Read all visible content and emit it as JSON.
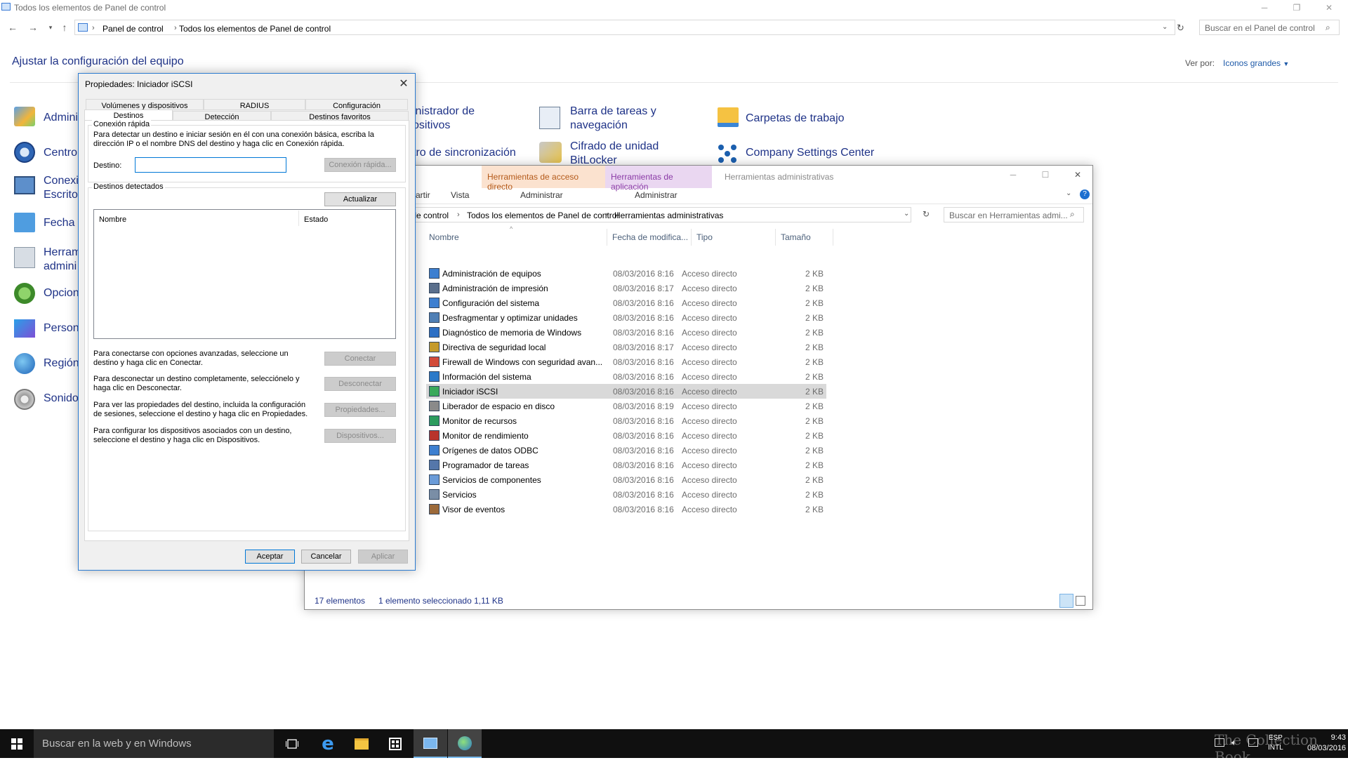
{
  "control_panel": {
    "window_title": "Todos los elementos de Panel de control",
    "breadcrumb": [
      "Panel de control",
      "Todos los elementos de Panel de control"
    ],
    "search_placeholder": "Buscar en el Panel de control",
    "heading": "Ajustar la configuración del equipo",
    "view_by_label": "Ver por:",
    "view_by_value": "Iconos grandes",
    "left_items": [
      "Admini",
      "Centro",
      "Conexi",
      "Escritor",
      "Fecha y",
      "Herram",
      "admini",
      "Opcion",
      "Person",
      "Región",
      "Sonido"
    ],
    "items_col2": [
      "inistrador de",
      "ositivos",
      "tro de sincronización"
    ],
    "items_col3": [
      "Barra de tareas y",
      "navegación",
      "Cifrado de unidad",
      "BitLocker"
    ],
    "items_col4": [
      "Carpetas de trabajo",
      "Company Settings Center"
    ]
  },
  "explorer": {
    "ctx_tab_shortcut": "Herramientas de acceso directo",
    "ctx_tab_app": "Herramientas de aplicación",
    "window_title": "Herramientas administrativas",
    "ribbon_tabs": [
      "artir",
      "Vista",
      "Administrar",
      "Administrar"
    ],
    "breadcrumb": [
      "nel de control",
      "Todos los elementos de Panel de control",
      "Herramientas administrativas"
    ],
    "search_placeholder": "Buscar en Herramientas admi...",
    "columns": [
      "Nombre",
      "Fecha de modifica...",
      "Tipo",
      "Tamaño"
    ],
    "rows": [
      {
        "name": "Administración de equipos",
        "date": "08/03/2016 8:16",
        "type": "Acceso directo",
        "size": "2 KB"
      },
      {
        "name": "Administración de impresión",
        "date": "08/03/2016 8:17",
        "type": "Acceso directo",
        "size": "2 KB"
      },
      {
        "name": "Configuración del sistema",
        "date": "08/03/2016 8:16",
        "type": "Acceso directo",
        "size": "2 KB"
      },
      {
        "name": "Desfragmentar y optimizar unidades",
        "date": "08/03/2016 8:16",
        "type": "Acceso directo",
        "size": "2 KB"
      },
      {
        "name": "Diagnóstico de memoria de Windows",
        "date": "08/03/2016 8:16",
        "type": "Acceso directo",
        "size": "2 KB"
      },
      {
        "name": "Directiva de seguridad local",
        "date": "08/03/2016 8:17",
        "type": "Acceso directo",
        "size": "2 KB"
      },
      {
        "name": "Firewall de Windows con seguridad avan...",
        "date": "08/03/2016 8:16",
        "type": "Acceso directo",
        "size": "2 KB"
      },
      {
        "name": "Información del sistema",
        "date": "08/03/2016 8:16",
        "type": "Acceso directo",
        "size": "2 KB"
      },
      {
        "name": "Iniciador iSCSI",
        "date": "08/03/2016 8:16",
        "type": "Acceso directo",
        "size": "2 KB"
      },
      {
        "name": "Liberador de espacio en disco",
        "date": "08/03/2016 8:19",
        "type": "Acceso directo",
        "size": "2 KB"
      },
      {
        "name": "Monitor de recursos",
        "date": "08/03/2016 8:16",
        "type": "Acceso directo",
        "size": "2 KB"
      },
      {
        "name": "Monitor de rendimiento",
        "date": "08/03/2016 8:16",
        "type": "Acceso directo",
        "size": "2 KB"
      },
      {
        "name": "Orígenes de datos ODBC",
        "date": "08/03/2016 8:16",
        "type": "Acceso directo",
        "size": "2 KB"
      },
      {
        "name": "Programador de tareas",
        "date": "08/03/2016 8:16",
        "type": "Acceso directo",
        "size": "2 KB"
      },
      {
        "name": "Servicios de componentes",
        "date": "08/03/2016 8:16",
        "type": "Acceso directo",
        "size": "2 KB"
      },
      {
        "name": "Servicios",
        "date": "08/03/2016 8:16",
        "type": "Acceso directo",
        "size": "2 KB"
      },
      {
        "name": "Visor de eventos",
        "date": "08/03/2016 8:16",
        "type": "Acceso directo",
        "size": "2 KB"
      }
    ],
    "selected_name": "Iniciador iSCSI",
    "status_count": "17 elementos",
    "status_selection": "1 elemento seleccionado  1,11 KB"
  },
  "dialog": {
    "title": "Propiedades: Iniciador iSCSI",
    "tabs_row1": [
      "Volúmenes y dispositivos",
      "RADIUS",
      "Configuración"
    ],
    "tabs_row2": [
      "Destinos",
      "Detección",
      "Destinos favoritos"
    ],
    "quick_connect_label": "Conexión rápida",
    "quick_connect_desc_1": "Para detectar un destino e iniciar sesión en él con una conexión básica, escriba la",
    "quick_connect_desc_2": "dirección IP o el nombre DNS del destino y haga clic en Conexión rápida.",
    "target_label": "Destino:",
    "target_value": "",
    "quick_connect_btn": "Conexión rápida...",
    "detected_label": "Destinos detectados",
    "refresh_btn": "Actualizar",
    "list_columns": [
      "Nombre",
      "Estado"
    ],
    "connect_text_1": "Para conectarse con opciones avanzadas, seleccione un",
    "connect_text_2": "destino y haga clic en Conectar.",
    "connect_btn": "Conectar",
    "disconnect_text_1": "Para desconectar un destino completamente, selecciónelo y",
    "disconnect_text_2": "haga clic en Desconectar.",
    "disconnect_btn": "Desconectar",
    "props_text_1": "Para ver las propiedades del destino, incluida la configuración",
    "props_text_2": "de sesiones, seleccione el destino y haga clic en Propiedades.",
    "props_btn": "Propiedades...",
    "devices_text_1": "Para configurar los dispositivos asociados con un destino,",
    "devices_text_2": "seleccione el destino y haga clic en Dispositivos.",
    "devices_btn": "Dispositivos...",
    "ok_btn": "Aceptar",
    "cancel_btn": "Cancelar",
    "apply_btn": "Aplicar"
  },
  "taskbar": {
    "search_placeholder": "Buscar en la web y en Windows",
    "lang_1": "ESP",
    "lang_2": "INTL",
    "time": "9:43",
    "date": "08/03/2016",
    "watermark": "The Collection Book"
  },
  "colors": {
    "accent": "#0078d7",
    "link": "#1e3287",
    "ctx_shortcut_bg": "#fbe2cf",
    "ctx_app_bg": "#ead7f1",
    "taskbar": "#101010"
  }
}
